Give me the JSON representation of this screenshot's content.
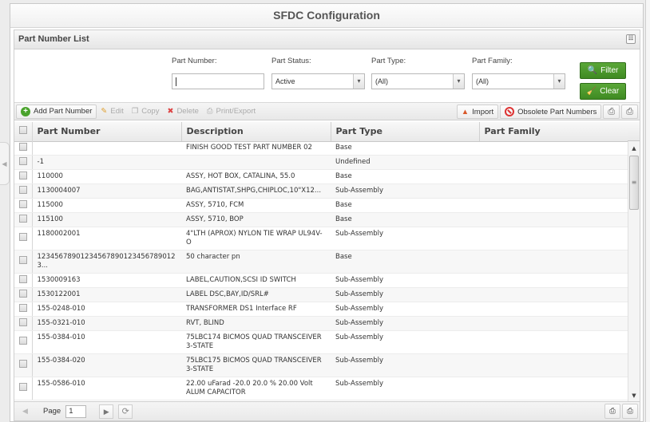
{
  "app": {
    "title": "SFDC Configuration"
  },
  "panel": {
    "title": "Part Number List"
  },
  "filters": {
    "part_number": {
      "label": "Part Number:",
      "value": ""
    },
    "part_status": {
      "label": "Part Status:",
      "value": "Active"
    },
    "part_type": {
      "label": "Part Type:",
      "value": "(All)"
    },
    "part_family": {
      "label": "Part Family:",
      "value": "(All)"
    },
    "filter_button": "Filter",
    "clear_button": "Clear"
  },
  "toolbar": {
    "add": "Add Part Number",
    "edit": "Edit",
    "copy": "Copy",
    "delete": "Delete",
    "print_export": "Print/Export",
    "import": "Import",
    "obsolete": "Obsolete Part Numbers"
  },
  "grid": {
    "columns": [
      "Part Number",
      "Description",
      "Part Type",
      "Part Family"
    ],
    "rows": [
      {
        "part_number": "",
        "description": "FINISH GOOD TEST PART NUMBER 02",
        "part_type": "Base",
        "part_family": ""
      },
      {
        "part_number": "-1",
        "description": "",
        "part_type": "Undefined",
        "part_family": ""
      },
      {
        "part_number": "110000",
        "description": "ASSY, HOT BOX, CATALINA, 55.0",
        "part_type": "Base",
        "part_family": ""
      },
      {
        "part_number": "1130004007",
        "description": "BAG,ANTISTAT,SHPG,CHIPLOC,10\"X12...",
        "part_type": "Sub-Assembly",
        "part_family": ""
      },
      {
        "part_number": "115000",
        "description": "ASSY, 5710, FCM",
        "part_type": "Base",
        "part_family": ""
      },
      {
        "part_number": "115100",
        "description": "ASSY, 5710, BOP",
        "part_type": "Base",
        "part_family": ""
      },
      {
        "part_number": "1180002001",
        "description": "4\"LTH (APROX) NYLON TIE WRAP UL94V-O",
        "part_type": "Sub-Assembly",
        "part_family": ""
      },
      {
        "part_number": "12345678901234567890123456789012 3...",
        "description": "50 character pn",
        "part_type": "Base",
        "part_family": ""
      },
      {
        "part_number": "1530009163",
        "description": "LABEL,CAUTION,SCSI ID SWITCH",
        "part_type": "Sub-Assembly",
        "part_family": ""
      },
      {
        "part_number": "1530122001",
        "description": "LABEL DSC,BAY,ID/SRL#",
        "part_type": "Sub-Assembly",
        "part_family": ""
      },
      {
        "part_number": "155-0248-010",
        "description": "TRANSFORMER DS1 Interface RF",
        "part_type": "Sub-Assembly",
        "part_family": ""
      },
      {
        "part_number": "155-0321-010",
        "description": "RVT, BLIND",
        "part_type": "Sub-Assembly",
        "part_family": ""
      },
      {
        "part_number": "155-0384-010",
        "description": "75LBC174 BICMOS QUAD TRANSCEIVER 3-STATE",
        "part_type": "Sub-Assembly",
        "part_family": ""
      },
      {
        "part_number": "155-0384-020",
        "description": "75LBC175 BICMOS QUAD TRANSCEIVER 3-STATE",
        "part_type": "Sub-Assembly",
        "part_family": ""
      },
      {
        "part_number": "155-0586-010",
        "description": "22.00 uFarad -20.0 20.0 % 20.00 Volt ALUM CAPACITOR",
        "part_type": "Sub-Assembly",
        "part_family": ""
      }
    ]
  },
  "pager": {
    "label": "Page",
    "page": "1"
  },
  "icons": {
    "collapse": "collapse-icon",
    "filter": "magnifier-icon",
    "clear": "broom-icon",
    "add": "plus-circle-icon",
    "edit": "pencil-icon",
    "copy": "copy-icon",
    "delete": "delete-icon",
    "print": "printer-icon",
    "import": "import-icon",
    "obsolete": "ban-icon"
  }
}
